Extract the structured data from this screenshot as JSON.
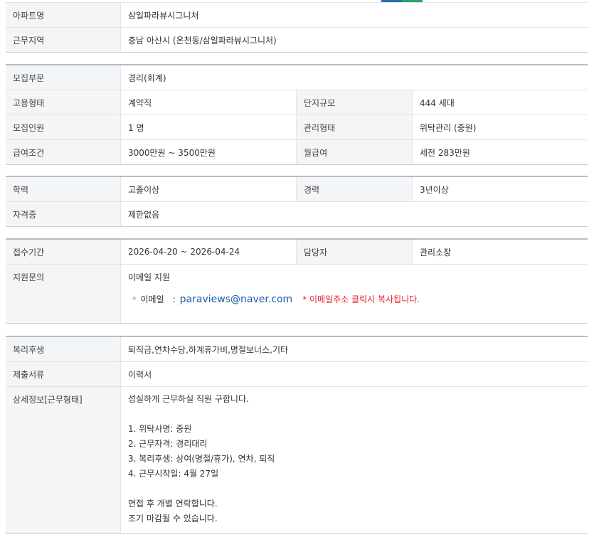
{
  "tab_indicator_colors": [
    "#2b6fb4",
    "#27a56a"
  ],
  "basic": [
    {
      "label": "아파트명",
      "value": "삼일파라뷰시그니처"
    },
    {
      "label": "근무지역",
      "value": "충남  아산시 (온천동/삼일파라뷰시그니처)"
    }
  ],
  "recruit": {
    "dept": {
      "label": "모집부문",
      "value": "경리(회계)"
    },
    "rows": [
      {
        "label": "고용형태",
        "value": "계약직",
        "label2": "단지규모",
        "value2": "444 세대"
      },
      {
        "label": "모집인원",
        "value": "1 명",
        "label2": "관리형태",
        "value2": "위탁관리 (중원)"
      },
      {
        "label": "급여조건",
        "value": "3000만원 ~ 3500만원",
        "label2": "월급여",
        "value2": "세전 283만원"
      }
    ]
  },
  "qualification": {
    "edu": {
      "label": "학력",
      "value": "고졸이상",
      "label2": "경력",
      "value2": "3년이상"
    },
    "cert": {
      "label": "자격증",
      "value": "제한없음"
    }
  },
  "apply": {
    "period": {
      "label": "접수기간",
      "value": "2026-04-20 ~ 2026-04-24",
      "label2": "담당자",
      "value2": "관리소장"
    },
    "inquiry_label": "지원문의",
    "inquiry_value": "이메일 지원",
    "email_bullet": "*",
    "email_label": "이메일",
    "email_sep": ":",
    "email": "paraviews@naver.com",
    "email_note": "* 이메일주소 클릭시 복사됩니다."
  },
  "extra": {
    "welfare": {
      "label": "복리후생",
      "value": "퇴직금,연차수당,하계휴가비,명절보너스,기타"
    },
    "docs": {
      "label": "제출서류",
      "value": "이력서"
    },
    "detail_label": "상세정보[근무형태]",
    "detail_lines": [
      "성실하게 근무하실 직원 구합니다.",
      "",
      "1. 위탁사명: 중원",
      "2. 근무자격: 경리대리",
      "3. 복리후생: 상여(명절/휴가), 연차, 퇴직",
      "4. 근무시작일: 4월 27일",
      "",
      "면접 후 개별 연락합니다.",
      "조기 마감될 수 있습니다."
    ]
  }
}
